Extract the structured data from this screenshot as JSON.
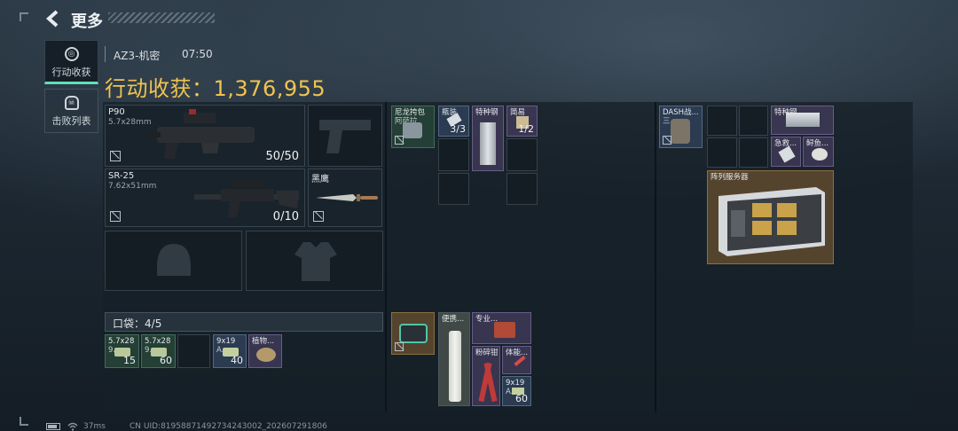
{
  "header": {
    "title": "更多"
  },
  "side_tabs": [
    {
      "label": "行动收获",
      "active": true
    },
    {
      "label": "击败列表",
      "active": false
    }
  ],
  "info": {
    "map": "AZ3-机密",
    "time": "07:50"
  },
  "haul": {
    "label": "行动收获：",
    "value": "1,376,955"
  },
  "weapons": [
    {
      "name": "P90",
      "caliber": "5.7x28mm",
      "ammo": "50/50"
    },
    {
      "name": "SR-25",
      "caliber": "7.62x51mm",
      "ammo": "0/10"
    }
  ],
  "melee": {
    "name": "黑鹰"
  },
  "pocket": {
    "label": "口袋：",
    "count": "4/5"
  },
  "pocket_items": [
    {
      "l1": "5.7x28",
      "l2": "9...",
      "count": "15"
    },
    {
      "l1": "5.7x28",
      "l2": "9...",
      "count": "60"
    },
    {
      "l1": "",
      "l2": "",
      "count": ""
    },
    {
      "l1": "9x19",
      "l2": "A...",
      "count": "40"
    },
    {
      "l1": "植物...",
      "l2": "",
      "count": ""
    }
  ],
  "rig": {
    "item1": {
      "l1": "尼龙挎包",
      "l2": "阿萨拉"
    },
    "bottle": {
      "label": "瓶装",
      "count": "3/3"
    },
    "steel": {
      "label": "特种钢"
    },
    "simple": {
      "label": "简易",
      "count": "1/2"
    }
  },
  "backpack_left": {
    "item1": {
      "label": "便携..."
    },
    "item2": {
      "label": "专业..."
    },
    "item3": {
      "label": "粉碎钳"
    },
    "item4": {
      "label": "体能..."
    },
    "item5": {
      "l1": "9x19",
      "l2": "A...",
      "count": "60"
    }
  },
  "backpack_right": {
    "dash": {
      "l1": "DASH战...",
      "l2": "三..."
    },
    "special": {
      "label": "特种钢"
    },
    "first_aid": {
      "label": "急救..."
    },
    "shark": {
      "label": "鲟鱼..."
    },
    "server": {
      "label": "阵列服务器"
    }
  },
  "footer": {
    "ping": "37ms",
    "uid": "CN UID:8195887149273424300​2_202607291806"
  },
  "colors": {
    "gold": "#f0c350",
    "accent": "#5fe0b8"
  }
}
